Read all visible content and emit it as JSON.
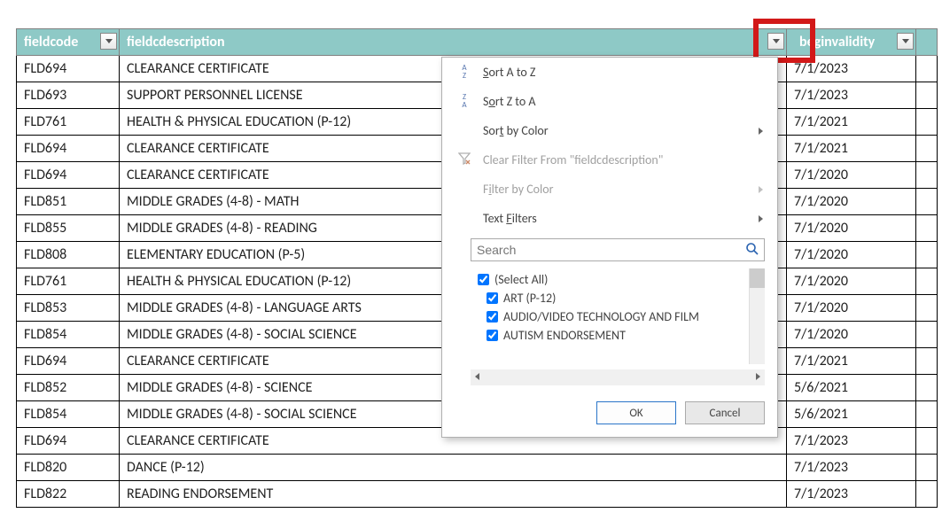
{
  "columns": {
    "fieldcode": "fieldcode",
    "fieldcdescription": "fieldcdescription",
    "beginvalidity": "beginvalidity"
  },
  "rows": [
    {
      "code": "FLD694",
      "desc": "CLEARANCE CERTIFICATE",
      "date": "7/1/2023"
    },
    {
      "code": "FLD693",
      "desc": "SUPPORT PERSONNEL LICENSE",
      "date": "7/1/2023"
    },
    {
      "code": "FLD761",
      "desc": "HEALTH & PHYSICAL EDUCATION (P-12)",
      "date": "7/1/2021"
    },
    {
      "code": "FLD694",
      "desc": "CLEARANCE CERTIFICATE",
      "date": "7/1/2021"
    },
    {
      "code": "FLD694",
      "desc": "CLEARANCE CERTIFICATE",
      "date": "7/1/2020"
    },
    {
      "code": "FLD851",
      "desc": "MIDDLE GRADES (4-8) - MATH",
      "date": "7/1/2020"
    },
    {
      "code": "FLD855",
      "desc": "MIDDLE GRADES (4-8) - READING",
      "date": "7/1/2020"
    },
    {
      "code": "FLD808",
      "desc": "ELEMENTARY EDUCATION (P-5)",
      "date": "7/1/2020"
    },
    {
      "code": "FLD761",
      "desc": "HEALTH & PHYSICAL EDUCATION (P-12)",
      "date": "7/1/2020"
    },
    {
      "code": "FLD853",
      "desc": "MIDDLE GRADES (4-8) - LANGUAGE ARTS",
      "date": "7/1/2020"
    },
    {
      "code": "FLD854",
      "desc": "MIDDLE GRADES (4-8) - SOCIAL SCIENCE",
      "date": "7/1/2020"
    },
    {
      "code": "FLD694",
      "desc": "CLEARANCE CERTIFICATE",
      "date": "7/1/2021"
    },
    {
      "code": "FLD852",
      "desc": "MIDDLE GRADES (4-8) - SCIENCE",
      "date": "5/6/2021"
    },
    {
      "code": "FLD854",
      "desc": "MIDDLE GRADES (4-8) - SOCIAL SCIENCE",
      "date": "5/6/2021"
    },
    {
      "code": "FLD694",
      "desc": "CLEARANCE CERTIFICATE",
      "date": "7/1/2023"
    },
    {
      "code": "FLD820",
      "desc": "DANCE (P-12)",
      "date": "7/1/2023"
    },
    {
      "code": "FLD822",
      "desc": "READING ENDORSEMENT",
      "date": "7/1/2023"
    }
  ],
  "popup": {
    "sort_az": "Sort A to Z",
    "sort_za": "Sort Z to A",
    "sort_color": "Sort by Color",
    "clear_filter": "Clear Filter From \"fieldcdescription\"",
    "filter_color": "Filter by Color",
    "text_filters": "Text Filters",
    "search_placeholder": "Search",
    "select_all": "(Select All)",
    "items": [
      "ART (P-12)",
      "AUDIO/VIDEO TECHNOLOGY AND FILM",
      "AUTISM ENDORSEMENT"
    ],
    "ok": "OK",
    "cancel": "Cancel"
  }
}
